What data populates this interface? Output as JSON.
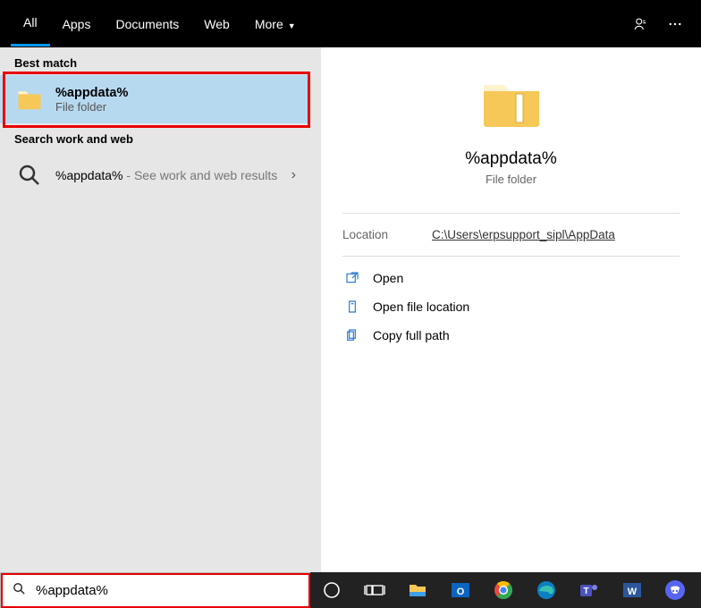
{
  "tabs": {
    "all": "All",
    "apps": "Apps",
    "documents": "Documents",
    "web": "Web",
    "more": "More"
  },
  "left": {
    "best_match_label": "Best match",
    "best": {
      "title": "%appdata%",
      "subtitle": "File folder"
    },
    "search_label": "Search work and web",
    "web": {
      "term": "%appdata%",
      "suffix": " - See work and web results"
    }
  },
  "preview": {
    "title": "%appdata%",
    "subtitle": "File folder",
    "location_label": "Location",
    "location_value": "C:\\Users\\erpsupport_sipl\\AppData",
    "actions": {
      "open": "Open",
      "openloc": "Open file location",
      "copy": "Copy full path"
    }
  },
  "search": {
    "value": "%appdata%"
  }
}
